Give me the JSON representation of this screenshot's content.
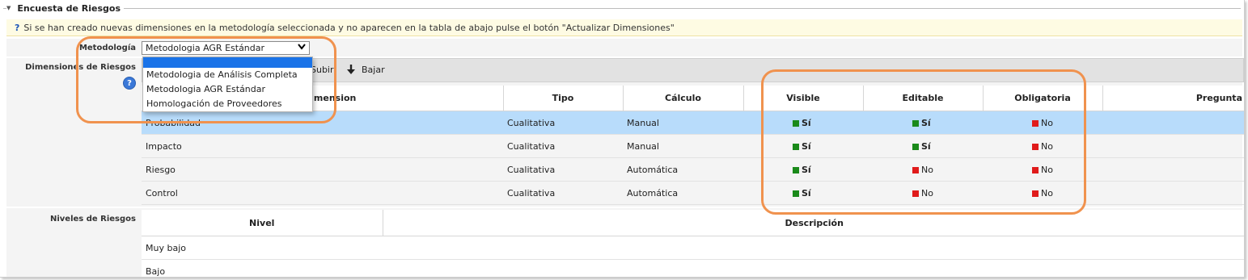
{
  "section": {
    "title": "Encuesta de Riesgos",
    "collapse_icon": "triangle-down-icon"
  },
  "info": {
    "icon": "question-icon",
    "text": "Si se han creado nuevas dimensiones en la metodología seleccionada y no aparecen en la tabla de abajo pulse el botón \"Actualizar Dimensiones\""
  },
  "metodologia": {
    "label": "Metodología",
    "selected": "Metodologia AGR Estándar",
    "options": [
      "",
      "Metodologia de Análisis Completa",
      "Metodologia AGR Estándar",
      "Homologación de Proveedores"
    ]
  },
  "dimensiones": {
    "label": "Dimensiones de Riesgos",
    "help_icon": "question-icon",
    "toolbar": {
      "subir": "Subir",
      "bajar": "Bajar"
    },
    "columns": [
      "Dimension",
      "Tipo",
      "Cálculo",
      "Visible",
      "Editable",
      "Obligatoria",
      "Pregunta"
    ],
    "rows": [
      {
        "dimension": "Probabilidad",
        "tipo": "Cualitativa",
        "calculo": "Manual",
        "visible": "Sí",
        "editable": "Sí",
        "obligatoria": "No"
      },
      {
        "dimension": "Impacto",
        "tipo": "Cualitativa",
        "calculo": "Manual",
        "visible": "Sí",
        "editable": "Sí",
        "obligatoria": "No"
      },
      {
        "dimension": "Riesgo",
        "tipo": "Cualitativa",
        "calculo": "Automática",
        "visible": "Sí",
        "editable": "No",
        "obligatoria": "No"
      },
      {
        "dimension": "Control",
        "tipo": "Cualitativa",
        "calculo": "Automática",
        "visible": "Sí",
        "editable": "No",
        "obligatoria": "No"
      }
    ]
  },
  "niveles": {
    "label": "Niveles de Riesgos",
    "columns": [
      "Nivel",
      "Descripción"
    ],
    "rows": [
      {
        "nivel": "Muy bajo",
        "descripcion": ""
      },
      {
        "nivel": "Bajo",
        "descripcion": ""
      }
    ]
  },
  "colors": {
    "yes": "#1a8a1a",
    "no": "#e01b1b",
    "highlight": "#f0924e",
    "selected_row": "#b8dcfb"
  }
}
